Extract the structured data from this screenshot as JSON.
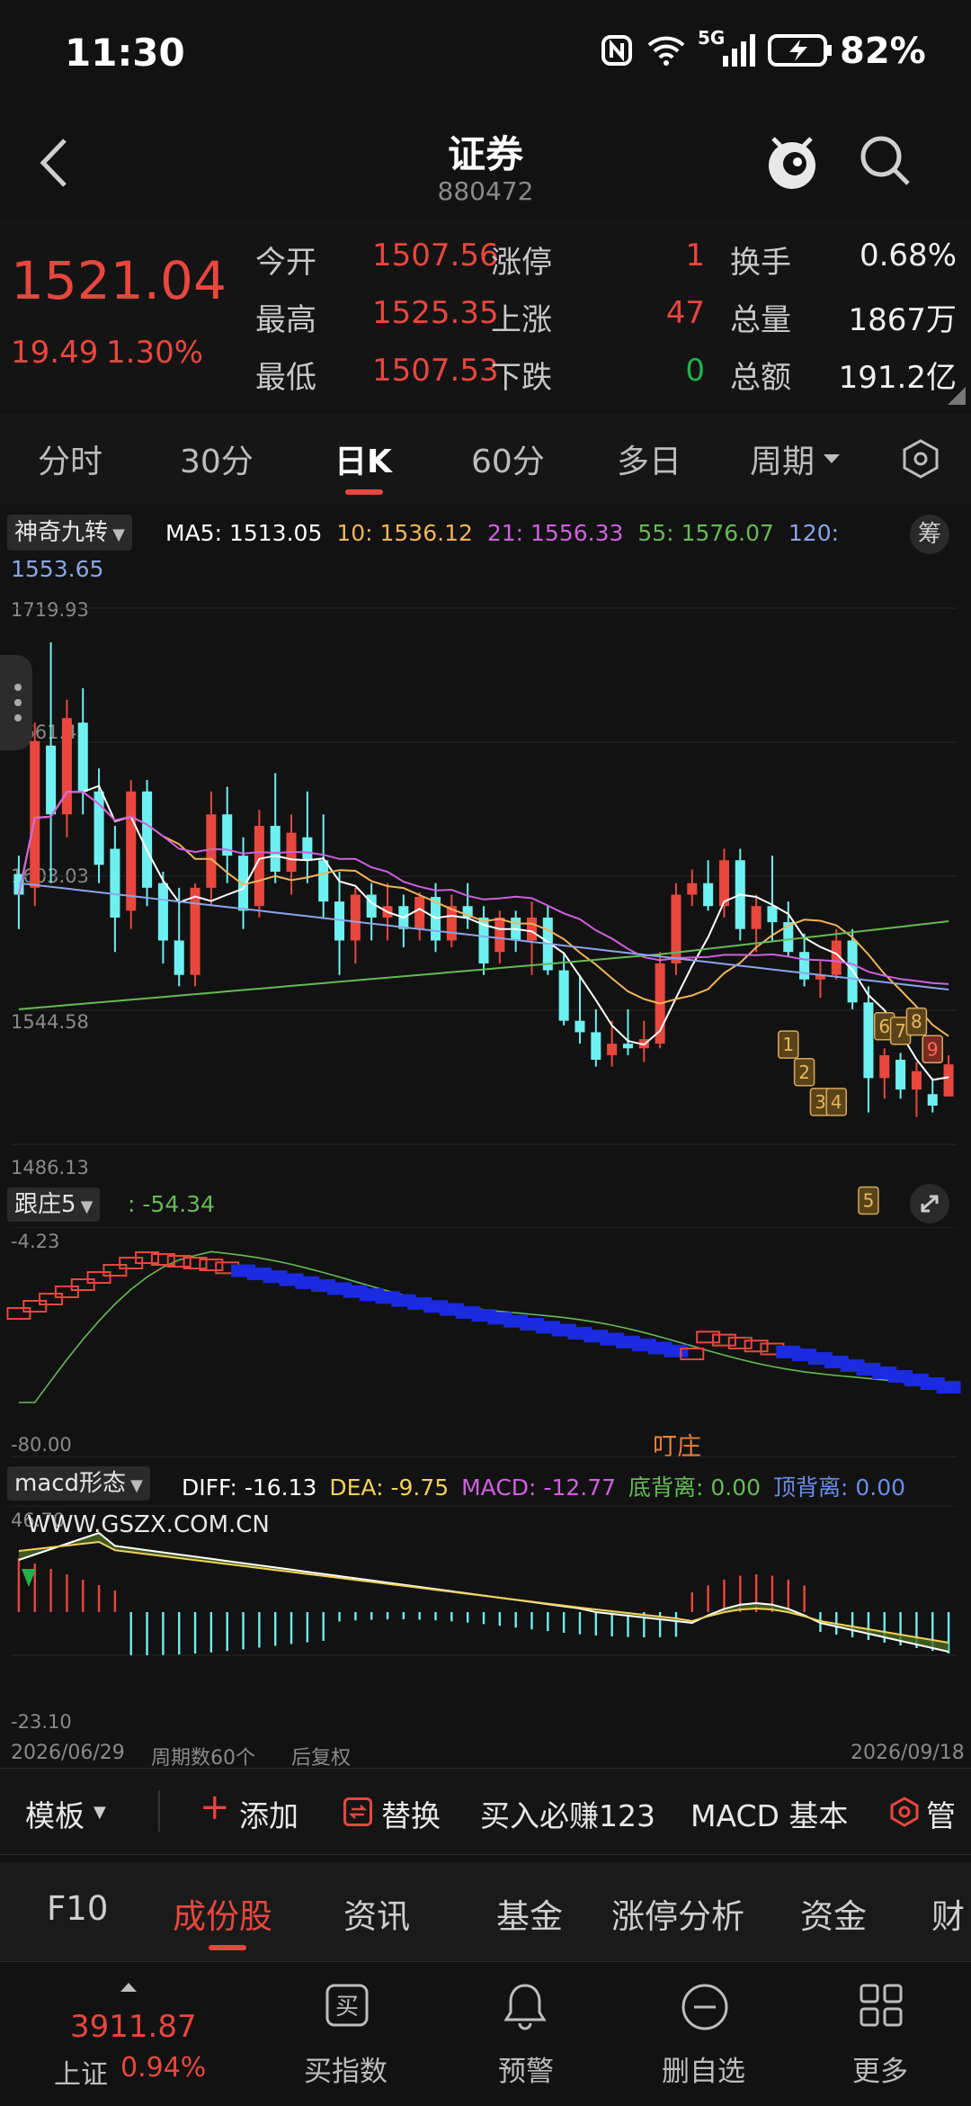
{
  "status": {
    "time": "11:30",
    "network": "5G",
    "battery": "82%"
  },
  "header": {
    "title": "证券",
    "code": "880472"
  },
  "quote": {
    "price": "1521.04",
    "change": "19.49",
    "change_pct": "1.30%",
    "rows": [
      {
        "l1": "今开",
        "v1": "1507.56",
        "l2": "涨停",
        "v2": "1",
        "l3": "换手",
        "v3": "0.68%"
      },
      {
        "l1": "最高",
        "v1": "1525.35",
        "l2": "上涨",
        "v2": "47",
        "l3": "总量",
        "v3": "1867万"
      },
      {
        "l1": "最低",
        "v1": "1507.53",
        "l2": "下跌",
        "v2": "0",
        "l3": "总额",
        "v3": "191.2亿"
      }
    ]
  },
  "tabs": [
    "分时",
    "30分",
    "日K",
    "60分",
    "多日",
    "周期"
  ],
  "tabs_active": "日K",
  "main_chart": {
    "indicator": "神奇九转",
    "ma5_label": "MA5:",
    "ma5": "1513.05",
    "ma10_label": "10:",
    "ma10": "1536.12",
    "ma21_label": "21:",
    "ma21": "1556.33",
    "ma55_label": "55:",
    "ma55": "1576.07",
    "ma120_label": "120:",
    "ma120": "1553.65",
    "chip_button": "筹",
    "y_labels": [
      "1719.93",
      "1661.48",
      "1603.03",
      "1544.58",
      "1486.13"
    ],
    "nine_numbers_up": [
      "1",
      "2",
      "3",
      "4"
    ],
    "nine_numbers_down": [
      "5",
      "6",
      "7",
      "8",
      "9"
    ]
  },
  "sub1": {
    "name": "跟庄5",
    "value_label": ":",
    "value": "-54.34",
    "top": "-4.23",
    "bottom": "-80.00",
    "annotation": "叮庄"
  },
  "sub2": {
    "name": "macd形态",
    "diff_label": "DIFF:",
    "diff": "-16.13",
    "dea_label": "DEA:",
    "dea": "-9.75",
    "macd_label": "MACD:",
    "macd": "-12.77",
    "bottom_div_label": "底背离:",
    "bottom_div": "0.00",
    "top_div_label": "顶背离:",
    "top_div": "0.00",
    "watermark": "WWW.GSZX.COM.CN",
    "top": "46.70",
    "bottom": "-23.10"
  },
  "axis": {
    "start": "2026/06/29",
    "period": "周期数60个",
    "adj": "后复权",
    "end": "2026/09/18"
  },
  "toolbar": {
    "template": "模板",
    "add": "添加",
    "replace": "替换",
    "promo": "买入必赚123",
    "macd": "MACD 基本",
    "more": "管"
  },
  "f10_tabs": [
    "F10",
    "成份股",
    "资讯",
    "基金",
    "涨停分析",
    "资金",
    "财"
  ],
  "f10_active": "成份股",
  "bottom_nav": {
    "index_value": "3911.87",
    "index_name": "上证",
    "index_pct": "0.94%",
    "items": [
      "买指数",
      "预警",
      "删自选",
      "更多"
    ]
  },
  "colors": {
    "up": "#e8473e",
    "down": "#6ef0f0",
    "ma5": "#ffffff",
    "ma10": "#f2b45a",
    "ma21": "#d060e0",
    "ma55": "#66bb55",
    "ma120": "#8aa6e8"
  },
  "chart_data": {
    "type": "candlestick",
    "x_range": [
      "2026/06/29",
      "2026/09/18"
    ],
    "periods": 60,
    "ylim": [
      1486.13,
      1719.93
    ],
    "candles": [
      [
        1604,
        1612,
        1580,
        1595
      ],
      [
        1598,
        1670,
        1590,
        1662
      ],
      [
        1660,
        1705,
        1600,
        1630
      ],
      [
        1630,
        1680,
        1620,
        1672
      ],
      [
        1670,
        1685,
        1630,
        1640
      ],
      [
        1640,
        1650,
        1600,
        1608
      ],
      [
        1615,
        1625,
        1570,
        1585
      ],
      [
        1588,
        1645,
        1580,
        1640
      ],
      [
        1640,
        1645,
        1590,
        1598
      ],
      [
        1600,
        1605,
        1565,
        1575
      ],
      [
        1575,
        1598,
        1555,
        1560
      ],
      [
        1560,
        1600,
        1555,
        1598
      ],
      [
        1598,
        1640,
        1590,
        1630
      ],
      [
        1630,
        1642,
        1600,
        1612
      ],
      [
        1612,
        1620,
        1580,
        1588
      ],
      [
        1590,
        1632,
        1585,
        1625
      ],
      [
        1625,
        1648,
        1600,
        1605
      ],
      [
        1605,
        1630,
        1595,
        1622
      ],
      [
        1620,
        1640,
        1600,
        1610
      ],
      [
        1610,
        1630,
        1585,
        1592
      ],
      [
        1592,
        1605,
        1560,
        1575
      ],
      [
        1575,
        1598,
        1565,
        1595
      ],
      [
        1595,
        1600,
        1575,
        1585
      ],
      [
        1585,
        1600,
        1575,
        1590
      ],
      [
        1590,
        1595,
        1572,
        1580
      ],
      [
        1580,
        1596,
        1575,
        1594
      ],
      [
        1594,
        1600,
        1570,
        1575
      ],
      [
        1575,
        1595,
        1572,
        1590
      ],
      [
        1590,
        1600,
        1580,
        1585
      ],
      [
        1585,
        1590,
        1560,
        1565
      ],
      [
        1570,
        1588,
        1565,
        1585
      ],
      [
        1585,
        1588,
        1570,
        1575
      ],
      [
        1575,
        1592,
        1560,
        1585
      ],
      [
        1585,
        1590,
        1560,
        1562
      ],
      [
        1562,
        1570,
        1538,
        1540
      ],
      [
        1540,
        1560,
        1530,
        1535
      ],
      [
        1535,
        1545,
        1520,
        1523
      ],
      [
        1525,
        1540,
        1520,
        1530
      ],
      [
        1530,
        1545,
        1525,
        1528
      ],
      [
        1528,
        1540,
        1522,
        1532
      ],
      [
        1530,
        1570,
        1528,
        1565
      ],
      [
        1565,
        1600,
        1560,
        1595
      ],
      [
        1595,
        1606,
        1590,
        1600
      ],
      [
        1600,
        1610,
        1588,
        1590
      ],
      [
        1590,
        1615,
        1585,
        1610
      ],
      [
        1610,
        1615,
        1575,
        1580
      ],
      [
        1580,
        1595,
        1570,
        1590
      ],
      [
        1590,
        1612,
        1575,
        1583
      ],
      [
        1583,
        1592,
        1568,
        1570
      ],
      [
        1570,
        1578,
        1555,
        1558
      ],
      [
        1558,
        1566,
        1550,
        1560
      ],
      [
        1560,
        1580,
        1558,
        1575
      ],
      [
        1575,
        1580,
        1545,
        1548
      ],
      [
        1548,
        1555,
        1500,
        1515
      ],
      [
        1515,
        1528,
        1506,
        1525
      ],
      [
        1523,
        1526,
        1506,
        1510
      ],
      [
        1510,
        1522,
        1498,
        1518
      ],
      [
        1508,
        1515,
        1500,
        1503
      ],
      [
        1507,
        1525,
        1507,
        1521
      ]
    ]
  }
}
